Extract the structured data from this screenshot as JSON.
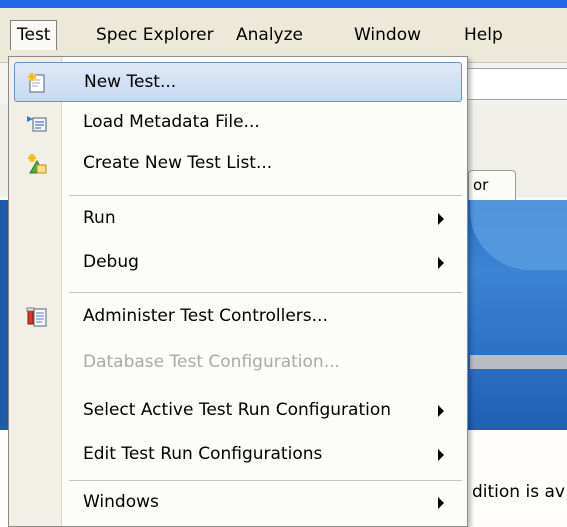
{
  "menubar": {
    "items": [
      {
        "label": "Test"
      },
      {
        "label": "Spec Explorer"
      },
      {
        "label": "Analyze"
      },
      {
        "label": "Window"
      },
      {
        "label": "Help"
      }
    ]
  },
  "menu": {
    "items": [
      {
        "label": "New Test...",
        "icon": "new-test-icon"
      },
      {
        "label": "Load Metadata File...",
        "icon": "load-metadata-icon"
      },
      {
        "label": "Create New Test List...",
        "icon": "new-test-list-icon"
      },
      {
        "label": "Run"
      },
      {
        "label": "Debug"
      },
      {
        "label": "Administer Test Controllers...",
        "icon": "test-controllers-icon"
      },
      {
        "label": "Database Test Configuration..."
      },
      {
        "label": "Select Active Test Run Configuration"
      },
      {
        "label": "Edit Test Run Configurations"
      },
      {
        "label": "Windows"
      }
    ]
  },
  "background": {
    "tab_label": "or",
    "footer_text": "dition is av"
  },
  "colors": {
    "accent": "#2266e8",
    "highlight": "#c7d9f2",
    "highlight_border": "#6c8ec9",
    "disabled_text": "#a9a9a9"
  }
}
